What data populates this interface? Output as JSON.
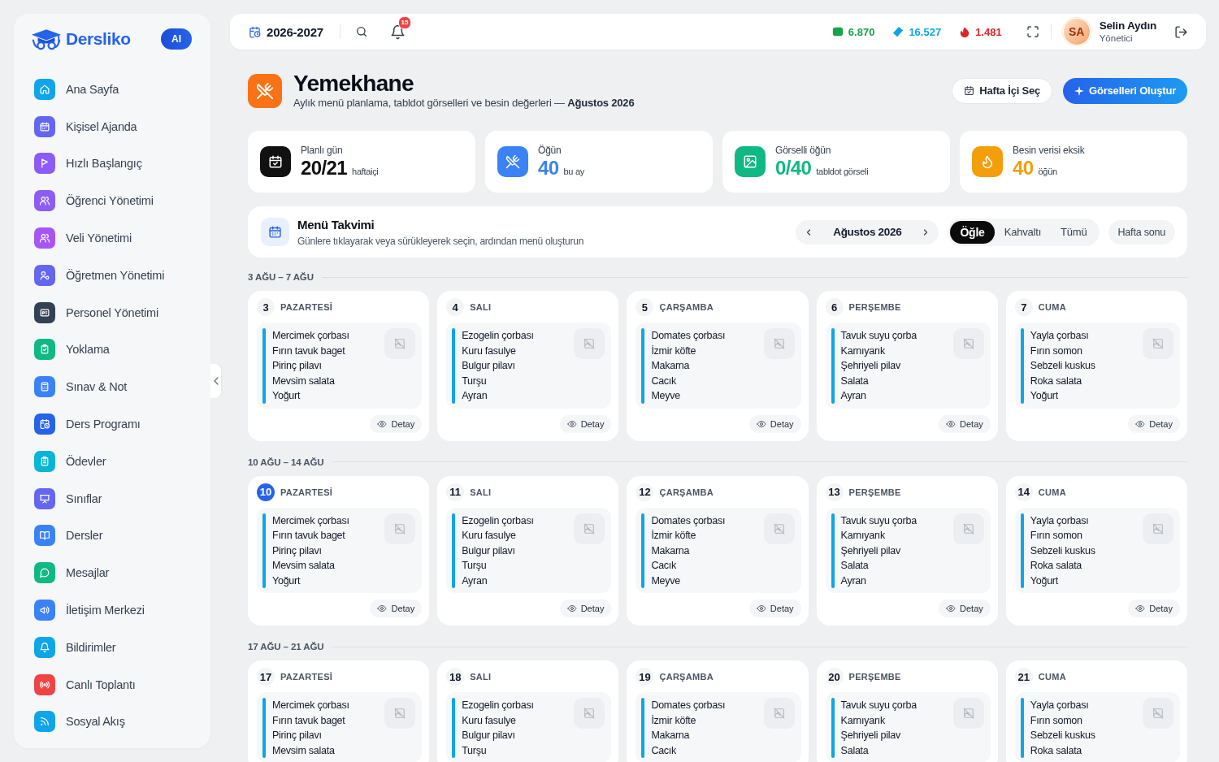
{
  "sidebar": {
    "brand": "Dersliko",
    "ai_label": "AI",
    "items": [
      {
        "label": "Ana Sayfa",
        "color": "#0ea5e9",
        "selected": false
      },
      {
        "label": "Kişisel Ajanda",
        "color": "#6366f1",
        "selected": false
      },
      {
        "label": "Hızlı Başlangıç",
        "color": "#8b5cf6",
        "selected": false
      },
      {
        "label": "Öğrenci Yönetimi",
        "color": "#8b5cf6",
        "selected": false
      },
      {
        "label": "Veli Yönetimi",
        "color": "#a855f7",
        "selected": false
      },
      {
        "label": "Öğretmen Yönetimi",
        "color": "#6366f1",
        "selected": false
      },
      {
        "label": "Personel Yönetimi",
        "color": "#334155",
        "selected": false
      },
      {
        "label": "Yoklama",
        "color": "#10b981",
        "selected": false
      },
      {
        "label": "Sınav & Not",
        "color": "#3b82f6",
        "selected": false
      },
      {
        "label": "Ders Programı",
        "color": "#2563eb",
        "selected": false
      },
      {
        "label": "Ödevler",
        "color": "#06b6d4",
        "selected": false
      },
      {
        "label": "Sınıflar",
        "color": "#6366f1",
        "selected": false
      },
      {
        "label": "Dersler",
        "color": "#3b82f6",
        "selected": false
      },
      {
        "label": "Mesajlar",
        "color": "#10b981",
        "selected": false
      },
      {
        "label": "İletişim Merkezi",
        "color": "#3b82f6",
        "selected": false
      },
      {
        "label": "Bildirimler",
        "color": "#0ea5e9",
        "selected": false
      },
      {
        "label": "Canlı Toplantı",
        "color": "#ef4444",
        "selected": false
      },
      {
        "label": "Sosyal Akış",
        "color": "#0ea5e9",
        "selected": false
      }
    ]
  },
  "topbar": {
    "school_year": "2026-2027",
    "notification_count": "15",
    "counters": [
      {
        "value": "6.870",
        "color": "#16a34a"
      },
      {
        "value": "16.527",
        "color": "#0ea5e9"
      },
      {
        "value": "1.481",
        "color": "#dc2626"
      }
    ],
    "user": {
      "initials": "SA",
      "name": "Selin Aydın",
      "role": "Yönetici"
    }
  },
  "header": {
    "title": "Yemekhane",
    "subtitle": "Aylık menü planlama, tabldot görselleri ve besin değerleri — **Ağustos 2026**",
    "buttons": [
      {
        "label": "Hafta İçi Seç",
        "kind": "secondary"
      },
      {
        "label": "Görselleri Oluştur",
        "kind": "primary"
      }
    ]
  },
  "stats": [
    {
      "label": "Planlı gün",
      "value": "20/21",
      "unit": "haftaiçi",
      "color": "#111111"
    },
    {
      "label": "Öğün",
      "value": "40",
      "unit": "bu ay",
      "color": "#3b82f6"
    },
    {
      "label": "Görselli öğün",
      "value": "0/40",
      "unit": "tabldot görseli",
      "color": "#10b981"
    },
    {
      "label": "Besin verisi eksik",
      "value": "40",
      "unit": "öğün",
      "color": "#f59e0b"
    }
  ],
  "menu_calendar": {
    "title": "Menü Takvimi",
    "subtitle": "Günlere tıklayarak veya sürükleyerek seçin, ardından menü oluşturun",
    "month": "Ağustos 2026",
    "meals": [
      {
        "label": "Öğle",
        "selected": true
      },
      {
        "label": "Kahvaltı",
        "selected": false
      },
      {
        "label": "Tümü",
        "selected": false
      }
    ],
    "weekend": {
      "label": "Hafta sonu",
      "on": false
    }
  },
  "weeks": [
    {
      "label": "3 AĞU – 7 AĞU",
      "days": [
        {
          "number": "3",
          "name": "PAZARTESİ",
          "today": false,
          "menu": [
            "Mercimek çorbası",
            "Fırın tavuk baget",
            "Pirinç pilavı",
            "Mevsim salata",
            "Yoğurt"
          ],
          "action": "Detay"
        },
        {
          "number": "4",
          "name": "SALI",
          "today": false,
          "menu": [
            "Ezogelin çorbası",
            "Kuru fasulye",
            "Bulgur pilavı",
            "Turşu",
            "Ayran"
          ],
          "action": "Detay"
        },
        {
          "number": "5",
          "name": "ÇARŞAMBA",
          "today": false,
          "menu": [
            "Domates çorbası",
            "İzmir köfte",
            "Makarna",
            "Cacık",
            "Meyve"
          ],
          "action": "Detay"
        },
        {
          "number": "6",
          "name": "PERŞEMBE",
          "today": false,
          "menu": [
            "Tavuk suyu çorba",
            "Karnıyarık",
            "Şehriyeli pilav",
            "Salata",
            "Ayran"
          ],
          "action": "Detay"
        },
        {
          "number": "7",
          "name": "CUMA",
          "today": false,
          "menu": [
            "Yayla çorbası",
            "Fırın somon",
            "Sebzeli kuskus",
            "Roka salata",
            "Yoğurt"
          ],
          "action": "Detay"
        }
      ]
    },
    {
      "label": "10 AĞU – 14 AĞU",
      "days": [
        {
          "number": "10",
          "name": "PAZARTESİ",
          "today": true,
          "menu": [
            "Mercimek çorbası",
            "Fırın tavuk baget",
            "Pirinç pilavı",
            "Mevsim salata",
            "Yoğurt"
          ],
          "action": "Detay"
        },
        {
          "number": "11",
          "name": "SALI",
          "today": false,
          "menu": [
            "Ezogelin çorbası",
            "Kuru fasulye",
            "Bulgur pilavı",
            "Turşu",
            "Ayran"
          ],
          "action": "Detay"
        },
        {
          "number": "12",
          "name": "ÇARŞAMBA",
          "today": false,
          "menu": [
            "Domates çorbası",
            "İzmir köfte",
            "Makarna",
            "Cacık",
            "Meyve"
          ],
          "action": "Detay"
        },
        {
          "number": "13",
          "name": "PERŞEMBE",
          "today": false,
          "menu": [
            "Tavuk suyu çorba",
            "Karnıyarık",
            "Şehriyeli pilav",
            "Salata",
            "Ayran"
          ],
          "action": "Detay"
        },
        {
          "number": "14",
          "name": "CUMA",
          "today": false,
          "menu": [
            "Yayla çorbası",
            "Fırın somon",
            "Sebzeli kuskus",
            "Roka salata",
            "Yoğurt"
          ],
          "action": "Detay"
        }
      ]
    },
    {
      "label": "17 AĞU – 21 AĞU",
      "days": [
        {
          "number": "17",
          "name": "PAZARTESİ",
          "today": false,
          "menu": [
            "Mercimek çorbası",
            "Fırın tavuk baget",
            "Pirinç pilavı",
            "Mevsim salata"
          ]
        },
        {
          "number": "18",
          "name": "SALI",
          "today": false,
          "menu": [
            "Ezogelin çorbası",
            "Kuru fasulye",
            "Bulgur pilavı",
            "Turşu"
          ]
        },
        {
          "number": "19",
          "name": "ÇARŞAMBA",
          "today": false,
          "menu": [
            "Domates çorbası",
            "İzmir köfte",
            "Makarna",
            "Cacık"
          ]
        },
        {
          "number": "20",
          "name": "PERŞEMBE",
          "today": false,
          "menu": [
            "Tavuk suyu çorba",
            "Karnıyarık",
            "Şehriyeli pilav",
            "Salata"
          ]
        },
        {
          "number": "21",
          "name": "CUMA",
          "today": false,
          "menu": [
            "Yayla çorbası",
            "Fırın somon",
            "Sebzeli kuskus",
            "Roka salata"
          ]
        }
      ]
    }
  ]
}
